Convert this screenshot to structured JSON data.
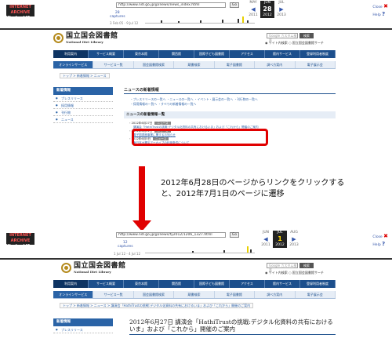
{
  "top": {
    "wayback": {
      "logo_line1": "INTERNET ARCHIVE",
      "logo_line2": "WaybackMachine",
      "url": "http://www.ndl.go.jp/jp/news/news_index.html",
      "go_label": "Go",
      "captures": "28",
      "captures_label": "captures",
      "capture_range": "3 Feb 05 - 9 Jul 12",
      "cal_prev_month": "MAY",
      "cal_cur_month": "JUN",
      "cal_next_month": "JUL",
      "cal_prev_day": "",
      "cal_cur_day": "28",
      "cal_next_day": "",
      "cal_prev_year": "2011",
      "cal_cur_year": "2012",
      "cal_next_year": "2013",
      "close_label": "Close",
      "help_label": "Help"
    },
    "site": {
      "name_jp": "国立国会図書館",
      "name_en": "National Diet Library",
      "search_placeholder": "Google カスタム検索",
      "search_button": "検索",
      "radio1": "サイト内検索",
      "radio2": "国立国会図書館サーチ",
      "nav1": [
        "利用案内",
        "サービス概要",
        "東京本館",
        "関西館",
        "国際子ども図書館",
        "アクセス",
        "館内サービス",
        "登録利用者制度"
      ],
      "nav1_active": "利用案内",
      "nav2": [
        "オンラインサービス",
        "サービス一覧",
        "国会図書館検索",
        "蔵書検索",
        "電子図書館",
        "調べ方案内",
        "電子展示会"
      ],
      "breadcrumb": "トップ > 新着情報 > ニュース",
      "sidebar_title": "新着情報",
      "sidebar_items": [
        "プレスリリース",
        "採用情報",
        "刊行物",
        "ニュース"
      ],
      "main_title": "ニュースの新着情報",
      "links_line1": "・プレスリリースの一覧へ ・ニュースの一覧へ ・イベント・展示会の一覧へ ・刊行物の一覧へ",
      "links_line2": "・採用情報の一覧へ ・すべての新着情報の一覧へ",
      "section_title": "ニュースの新着情報一覧",
      "news": [
        {
          "date": "2012年6月27日",
          "tag": "ニュース",
          "title": "講演会「HathiTrustの挑戦:デジタル化資料の共有におけるいま」および「これから」開催のご案内"
        },
        {
          "date": "2012年6月21日",
          "tag": "ニュース",
          "title": "電子図書館事業に関するお知らせ"
        },
        {
          "date": "2012年6月5日",
          "tag": "ニュース",
          "title": "東日本大震災アーカイブの利用条件について"
        }
      ]
    }
  },
  "caption": {
    "line1": "2012年6月28日のページからリンクをクリックする",
    "line2": "と、2012年7月1日のページに遷移"
  },
  "bottom": {
    "wayback": {
      "logo_line1": "INTERNET ARCHIVE",
      "logo_line2": "WaybackMachine",
      "url": "http://www.ndl.go.jp/jp/news/fy2012/1206_1327.html",
      "go_label": "Go",
      "captures": "12",
      "captures_label": "captures",
      "capture_range": "1 Jul 12 - 4 Jul 12",
      "cal_prev_month": "JUN",
      "cal_cur_month": "JUL",
      "cal_next_month": "AUG",
      "cal_prev_day": "",
      "cal_cur_day": "1",
      "cal_next_day": "",
      "cal_prev_year": "2011",
      "cal_cur_year": "2012",
      "cal_next_year": "2013",
      "close_label": "Close",
      "help_label": "Help"
    },
    "site": {
      "name_jp": "国立国会図書館",
      "name_en": "National Diet Library",
      "search_placeholder": "Google カスタム検索",
      "search_button": "検索",
      "radio1": "サイト内検索",
      "radio2": "国立国会図書館サーチ",
      "nav1": [
        "利用案内",
        "サービス概要",
        "東京本館",
        "関西館",
        "国際子ども図書館",
        "アクセス",
        "館内サービス",
        "登録利用者制度"
      ],
      "nav2": [
        "オンラインサービス",
        "サービス一覧",
        "国会図書館検索",
        "蔵書検索",
        "電子図書館",
        "調べ方案内",
        "電子展示会"
      ],
      "breadcrumb": "トップ > 新着情報 > ニュース > 講演会「HathiTrustの挑戦:デジタル化資料の共有におけるいま」および「これから」開催のご案内",
      "sidebar_title": "新着情報",
      "sidebar_items": [
        "プレスリリース"
      ],
      "page_heading": "2012年6月27日 講演会「HathiTrustの挑戦:デジタル化資料の共有におけるいま」および「これから」開催のご案内"
    }
  },
  "colors": {
    "nav_primary": "#1c4f8c",
    "nav_secondary": "#e6edf6",
    "highlight": "#e00000",
    "arrow": "#e00000"
  }
}
